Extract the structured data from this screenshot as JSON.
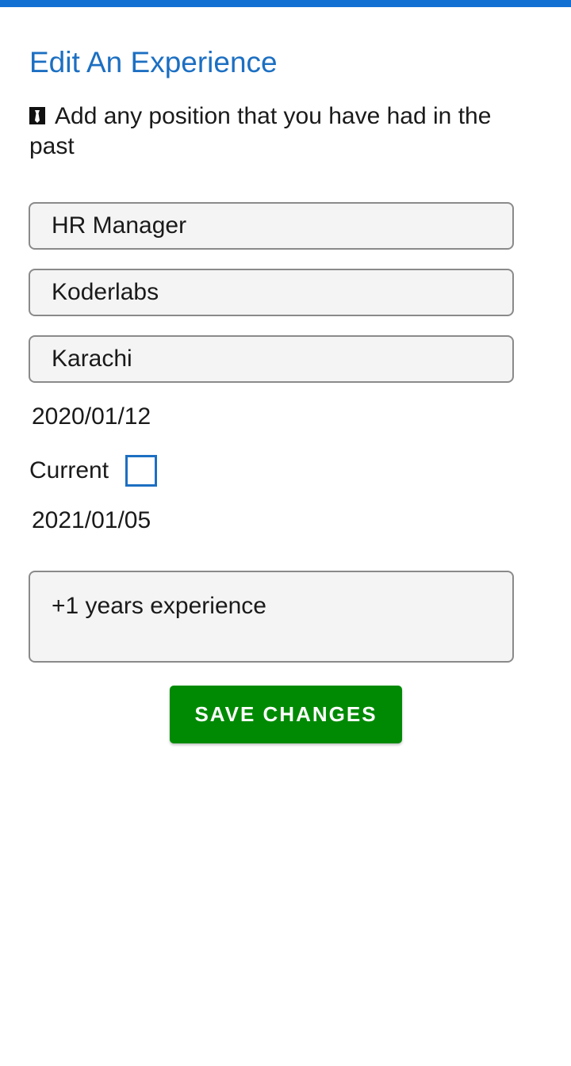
{
  "header": {
    "title": "Edit An Experience",
    "subtitle": "Add any position that you have had in the past",
    "subtitle_icon": "necktie-icon",
    "accent_color": "#1370d3"
  },
  "form": {
    "position": {
      "value": "HR Manager"
    },
    "company": {
      "value": "Koderlabs"
    },
    "location": {
      "value": "Karachi"
    },
    "start_date": "2020/01/12",
    "current_label": "Current",
    "current_checked": false,
    "end_date": "2021/01/05",
    "description": {
      "value": "+1 years experience"
    }
  },
  "actions": {
    "save_label": "SAVE CHANGES",
    "save_color": "#008a04"
  }
}
